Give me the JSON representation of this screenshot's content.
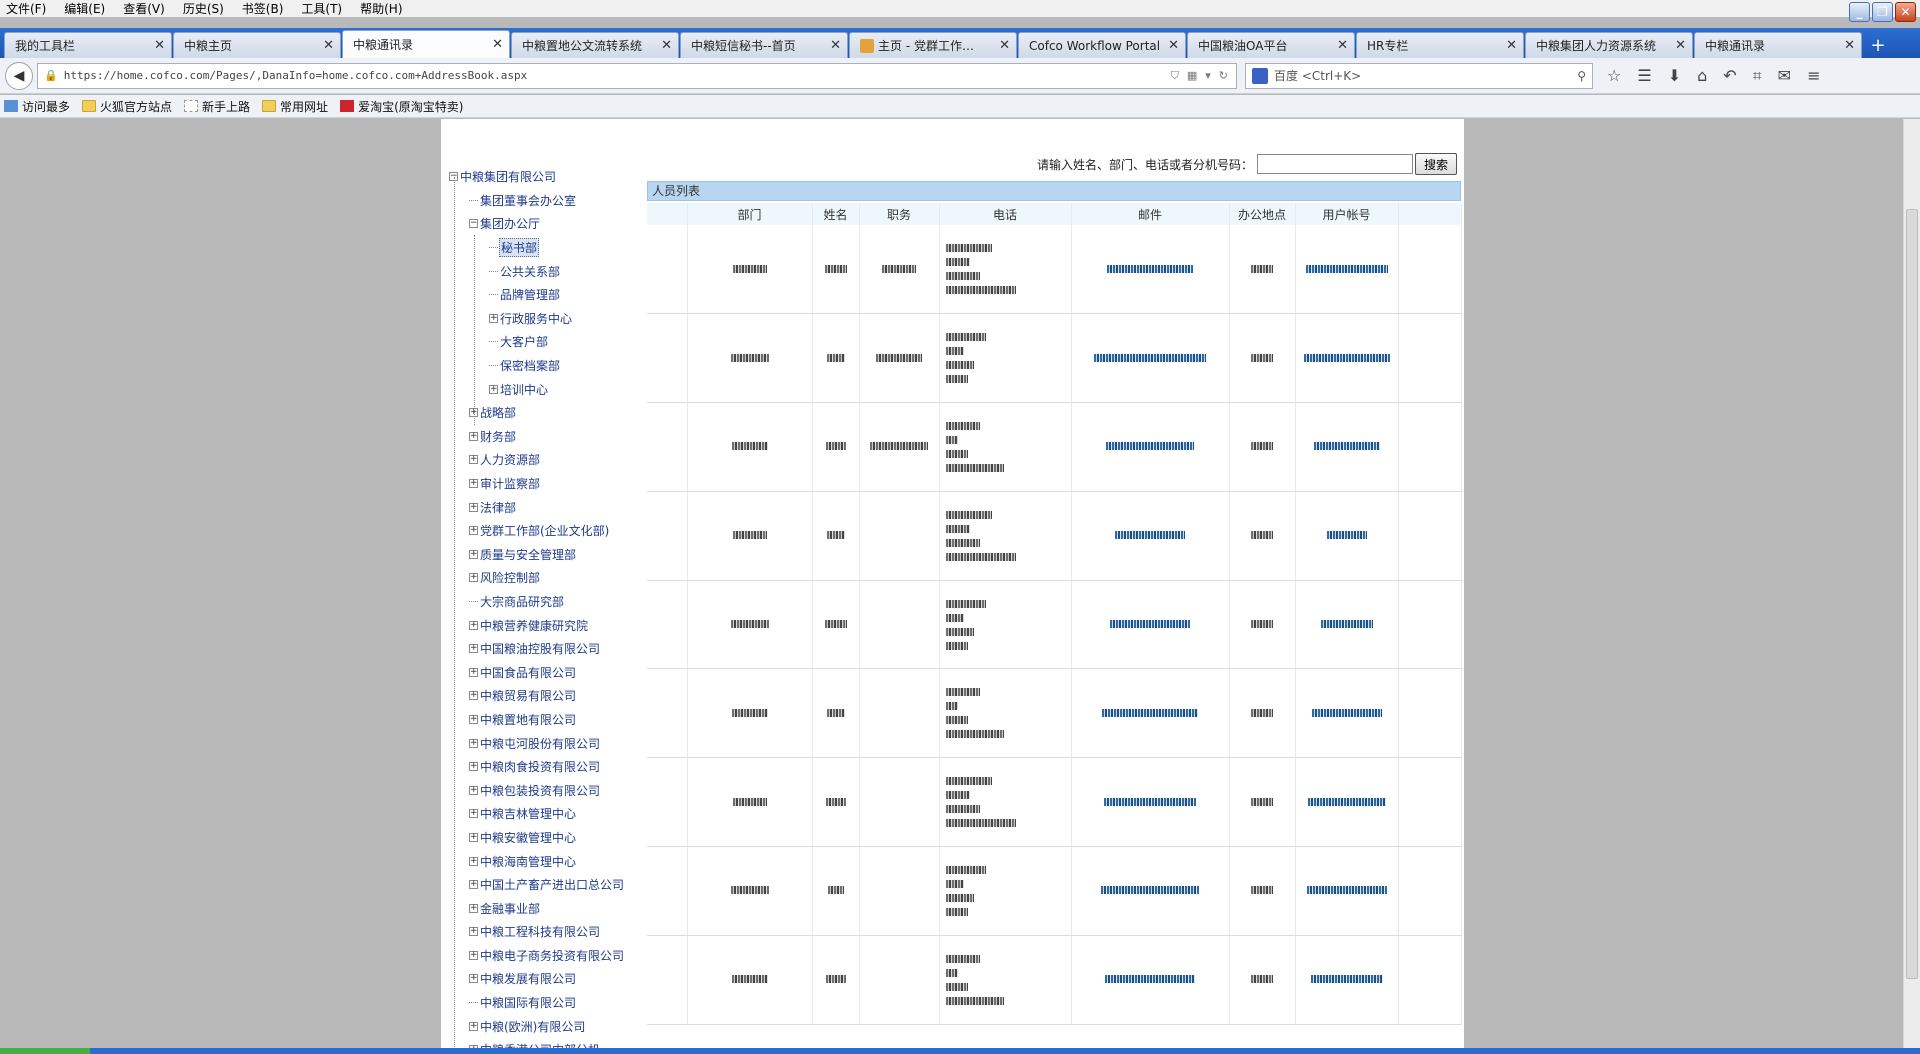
{
  "menu": [
    "文件(F)",
    "编辑(E)",
    "查看(V)",
    "历史(S)",
    "书签(B)",
    "工具(T)",
    "帮助(H)"
  ],
  "tabs": [
    {
      "label": "我的工具栏"
    },
    {
      "label": "中粮主页"
    },
    {
      "label": "中粮通讯录",
      "active": true
    },
    {
      "label": "中粮置地公文流转系统"
    },
    {
      "label": "中粮短信秘书--首页"
    },
    {
      "label": "主页 - 党群工作…",
      "icon": true
    },
    {
      "label": "Cofco Workflow Portal"
    },
    {
      "label": "中国粮油OA平台"
    },
    {
      "label": "HR专栏"
    },
    {
      "label": "中粮集团人力资源系统"
    },
    {
      "label": "中粮通讯录"
    }
  ],
  "address": {
    "url": "https://home.cofco.com/Pages/,DanaInfo=home.cofco.com+AddressBook.aspx"
  },
  "search_engine": {
    "placeholder": "百度 <Ctrl+K>"
  },
  "bookmarks": [
    {
      "label": "访问最多",
      "icon": "blue"
    },
    {
      "label": "火狐官方站点",
      "icon": "folder"
    },
    {
      "label": "新手上路",
      "icon": "page"
    },
    {
      "label": "常用网址",
      "icon": "folder"
    },
    {
      "label": "爱淘宝(原淘宝特卖)",
      "icon": "red"
    }
  ],
  "page": {
    "search_label": "请输入姓名、部门、电话或者分机号码：",
    "search_value": "",
    "search_button": "搜索",
    "list_title": "人员列表",
    "columns": [
      "部门",
      "姓名",
      "职务",
      "电话",
      "邮件",
      "办公地点",
      "用户帐号"
    ],
    "row_count": 9
  },
  "tree": [
    {
      "label": "中粮集团有限公司",
      "level": 0,
      "toggle": "−"
    },
    {
      "label": "集团董事会办公室",
      "level": 1
    },
    {
      "label": "集团办公厅",
      "level": 1,
      "toggle": "−"
    },
    {
      "label": "秘书部",
      "level": 2,
      "selected": true
    },
    {
      "label": "公共关系部",
      "level": 2
    },
    {
      "label": "品牌管理部",
      "level": 2
    },
    {
      "label": "行政服务中心",
      "level": 2,
      "toggle": "+"
    },
    {
      "label": "大客户部",
      "level": 2
    },
    {
      "label": "保密档案部",
      "level": 2
    },
    {
      "label": "培训中心",
      "level": 2,
      "toggle": "+"
    },
    {
      "label": "战略部",
      "level": 1,
      "toggle": "+"
    },
    {
      "label": "财务部",
      "level": 1,
      "toggle": "+"
    },
    {
      "label": "人力资源部",
      "level": 1,
      "toggle": "+"
    },
    {
      "label": "审计监察部",
      "level": 1,
      "toggle": "+"
    },
    {
      "label": "法律部",
      "level": 1,
      "toggle": "+"
    },
    {
      "label": "党群工作部(企业文化部)",
      "level": 1,
      "toggle": "+"
    },
    {
      "label": "质量与安全管理部",
      "level": 1,
      "toggle": "+"
    },
    {
      "label": "风险控制部",
      "level": 1,
      "toggle": "+"
    },
    {
      "label": "大宗商品研究部",
      "level": 1
    },
    {
      "label": "中粮营养健康研究院",
      "level": 1,
      "toggle": "+"
    },
    {
      "label": "中国粮油控股有限公司",
      "level": 1,
      "toggle": "+"
    },
    {
      "label": "中国食品有限公司",
      "level": 1,
      "toggle": "+"
    },
    {
      "label": "中粮贸易有限公司",
      "level": 1,
      "toggle": "+"
    },
    {
      "label": "中粮置地有限公司",
      "level": 1,
      "toggle": "+"
    },
    {
      "label": "中粮屯河股份有限公司",
      "level": 1,
      "toggle": "+"
    },
    {
      "label": "中粮肉食投资有限公司",
      "level": 1,
      "toggle": "+"
    },
    {
      "label": "中粮包装投资有限公司",
      "level": 1,
      "toggle": "+"
    },
    {
      "label": "中粮吉林管理中心",
      "level": 1,
      "toggle": "+"
    },
    {
      "label": "中粮安徽管理中心",
      "level": 1,
      "toggle": "+"
    },
    {
      "label": "中粮海南管理中心",
      "level": 1,
      "toggle": "+"
    },
    {
      "label": "中国土产畜产进出口总公司",
      "level": 1,
      "toggle": "+"
    },
    {
      "label": "金融事业部",
      "level": 1,
      "toggle": "+"
    },
    {
      "label": "中粮工程科技有限公司",
      "level": 1,
      "toggle": "+"
    },
    {
      "label": "中粮电子商务投资有限公司",
      "level": 1,
      "toggle": "+"
    },
    {
      "label": "中粮发展有限公司",
      "level": 1,
      "toggle": "+"
    },
    {
      "label": "中粮国际有限公司",
      "level": 1
    },
    {
      "label": "中粮(欧洲)有限公司",
      "level": 1,
      "toggle": "+"
    },
    {
      "label": "中粮香港公司内部分机",
      "level": 1,
      "toggle": "+"
    }
  ]
}
